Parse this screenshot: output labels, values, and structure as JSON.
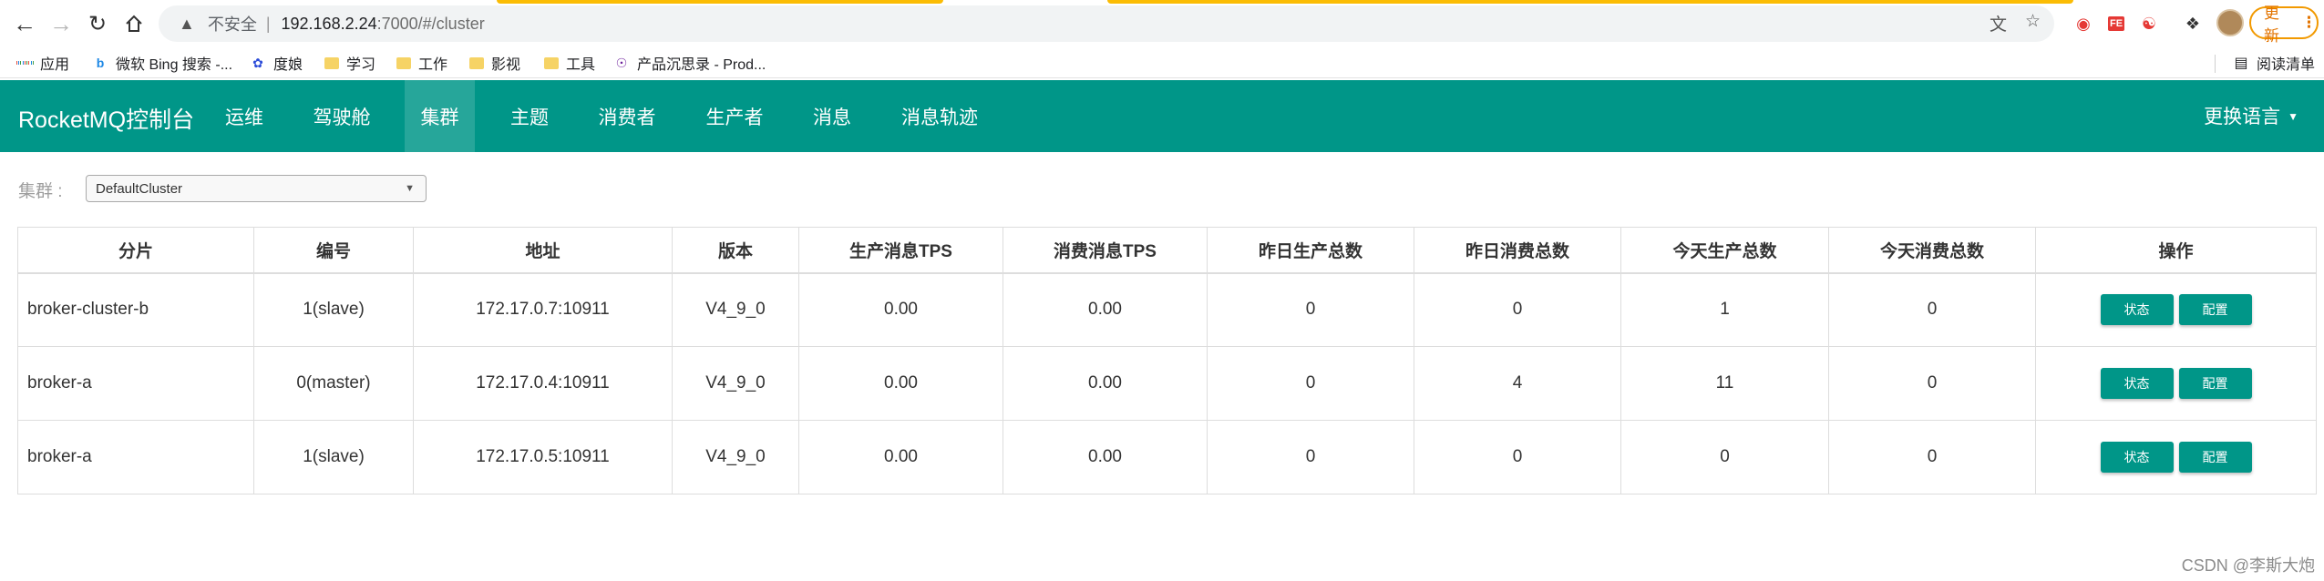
{
  "browser": {
    "insecure_label": "不安全",
    "separator": "|",
    "url_host": "192.168.2.24",
    "url_path": ":7000/#/cluster",
    "update_label": "更新",
    "update_more": "⋮",
    "icons": [
      "back-icon",
      "forward-icon",
      "reload-icon",
      "home-icon",
      "warning-icon",
      "translate-icon",
      "star-icon",
      "extension-icon",
      "profile-avatar"
    ]
  },
  "bookmarks": [
    {
      "label": "应用",
      "icon": "apps-grid-icon"
    },
    {
      "label": "微软 Bing 搜索 -...",
      "icon": "bing-icon"
    },
    {
      "label": "度娘",
      "icon": "baidu-icon"
    },
    {
      "label": "学习",
      "icon": "folder-icon"
    },
    {
      "label": "工作",
      "icon": "folder-icon"
    },
    {
      "label": "影视",
      "icon": "folder-icon"
    },
    {
      "label": "工具",
      "icon": "folder-icon"
    },
    {
      "label": "产品沉思录 - Prod...",
      "icon": "site-icon"
    },
    {
      "label": "阅读清单",
      "icon": "reading-list-icon"
    }
  ],
  "navbar": {
    "brand": "RocketMQ控制台",
    "items": [
      {
        "label": "运维"
      },
      {
        "label": "驾驶舱"
      },
      {
        "label": "集群"
      },
      {
        "label": "主题"
      },
      {
        "label": "消费者"
      },
      {
        "label": "生产者"
      },
      {
        "label": "消息"
      },
      {
        "label": "消息轨迹"
      }
    ],
    "active": "集群",
    "language": "更换语言",
    "background": "#009688",
    "active_background": "#26a69a"
  },
  "cluster": {
    "label": "集群 :",
    "selected": "DefaultCluster"
  },
  "table": {
    "headers": [
      "分片",
      "编号",
      "地址",
      "版本",
      "生产消息TPS",
      "消费消息TPS",
      "昨日生产总数",
      "昨日消费总数",
      "今天生产总数",
      "今天消费总数",
      "操作"
    ],
    "rows": [
      [
        "broker-cluster-b",
        "1(slave)",
        "172.17.0.7:10911",
        "V4_9_0",
        "0.00",
        "0.00",
        "0",
        "0",
        "1",
        "0"
      ],
      [
        "broker-a",
        "0(master)",
        "172.17.0.4:10911",
        "V4_9_0",
        "0.00",
        "0.00",
        "0",
        "4",
        "11",
        "0"
      ],
      [
        "broker-a",
        "1(slave)",
        "172.17.0.5:10911",
        "V4_9_0",
        "0.00",
        "0.00",
        "0",
        "0",
        "0",
        "0"
      ]
    ],
    "actions": {
      "status": "状态",
      "config": "配置"
    }
  },
  "watermark": "CSDN @李斯大炮"
}
